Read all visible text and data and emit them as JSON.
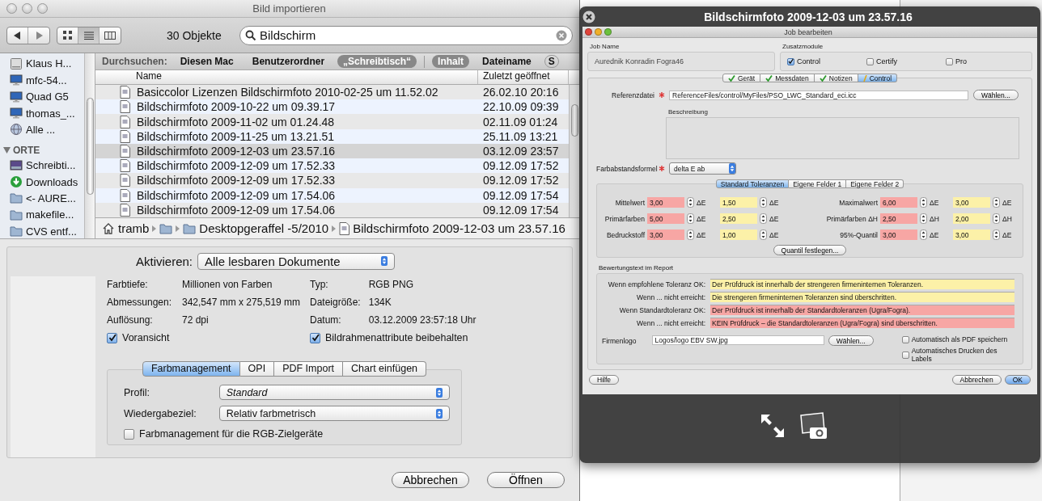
{
  "import_dialog": {
    "title": "Bild importieren",
    "toolbar": {
      "view_modes": [
        {
          "kind": "icons",
          "selected": false
        },
        {
          "kind": "list",
          "selected": true
        },
        {
          "kind": "columns",
          "selected": false
        }
      ],
      "count": "30 Objekte",
      "search": {
        "value": "Bildschirm"
      }
    },
    "sidebar": {
      "devices": [
        {
          "label": "Klaus H...",
          "kind": "drive"
        },
        {
          "label": "mfc-54...",
          "kind": "monitor"
        },
        {
          "label": "Quad G5",
          "kind": "monitor"
        },
        {
          "label": "thomas_...",
          "kind": "monitor"
        },
        {
          "label": "Alle ...",
          "kind": "network"
        }
      ],
      "places_heading": "ORTE",
      "places": [
        {
          "label": "Schreibti...",
          "kind": "desktop"
        },
        {
          "label": "Downloads",
          "kind": "downloads"
        },
        {
          "label": "<- AURE...",
          "kind": "folder"
        },
        {
          "label": "makefile...",
          "kind": "folder"
        },
        {
          "label": "CVS entf...",
          "kind": "folder"
        }
      ]
    },
    "scope_bar": {
      "label": "Durchsuchen:",
      "scopes": [
        {
          "label": "Diesen Mac",
          "selected": false
        },
        {
          "label": "Benutzerordner",
          "selected": false
        },
        {
          "label": "„Schreibtisch“",
          "selected": true
        }
      ],
      "fields": [
        {
          "label": "Inhalt",
          "selected": true
        },
        {
          "label": "Dateiname",
          "selected": false
        },
        {
          "label": "S",
          "selected": false
        }
      ]
    },
    "table": {
      "columns": [
        "Name",
        "Zuletzt geöffnet"
      ],
      "rows": [
        {
          "name": "Basiccolor Lizenzen Bildschirmfoto 2010-02-25 um 11.52.02",
          "opened": "26.02.10 20:16",
          "selected": false
        },
        {
          "name": "Bildschirmfoto 2009-10-22 um 09.39.17",
          "opened": "22.10.09 09:39",
          "selected": false
        },
        {
          "name": "Bildschirmfoto 2009-11-02 um 01.24.48",
          "opened": "02.11.09 01:24",
          "selected": false
        },
        {
          "name": "Bildschirmfoto 2009-11-25 um 13.21.51",
          "opened": "25.11.09 13:21",
          "selected": false
        },
        {
          "name": "Bildschirmfoto 2009-12-03 um 23.57.16",
          "opened": "03.12.09 23:57",
          "selected": true
        },
        {
          "name": "Bildschirmfoto 2009-12-09 um 17.52.33",
          "opened": "09.12.09 17:52",
          "selected": false
        },
        {
          "name": "Bildschirmfoto 2009-12-09 um 17.52.33",
          "opened": "09.12.09 17:52",
          "selected": false
        },
        {
          "name": "Bildschirmfoto 2009-12-09 um 17.54.06",
          "opened": "09.12.09 17:54",
          "selected": false
        },
        {
          "name": "Bildschirmfoto 2009-12-09 um 17.54.06",
          "opened": "09.12.09 17:54",
          "selected": false
        }
      ]
    },
    "path_bar": [
      {
        "kind": "home",
        "label": "tramb"
      },
      {
        "kind": "folder"
      },
      {
        "kind": "folder",
        "label": "Desktopgeraffel -5/2010"
      },
      {
        "kind": "file",
        "label": "Bildschirmfoto 2009-12-03 um 23.57.16"
      }
    ],
    "activate": {
      "label": "Aktivieren:",
      "value": "Alle lesbaren Dokumente"
    },
    "info": [
      {
        "label": "Farbtiefe:",
        "value": "Millionen von Farben"
      },
      {
        "label": "Typ:",
        "value": "RGB PNG"
      },
      {
        "label": "Abmessungen:",
        "value": "342,547 mm x 275,519 mm"
      },
      {
        "label": "Dateigröße:",
        "value": "134K"
      },
      {
        "label": "Auflösung:",
        "value": "72 dpi"
      },
      {
        "label": "Datum:",
        "value": "03.12.2009 23:57:18 Uhr"
      }
    ],
    "checkboxes": [
      {
        "label": "Voransicht",
        "checked": true
      },
      {
        "label": "Bildrahmenattribute beibehalten",
        "checked": true
      }
    ],
    "tabs": [
      {
        "label": "Farbmanagement",
        "selected": true
      },
      {
        "label": "OPI",
        "selected": false
      },
      {
        "label": "PDF Import",
        "selected": false
      },
      {
        "label": "Chart einfügen",
        "selected": false
      }
    ],
    "color_management": {
      "popups": [
        {
          "label": "Profil:",
          "value": "Standard",
          "italic": true
        },
        {
          "label": "Wiedergabeziel:",
          "value": "Relativ farbmetrisch",
          "italic": false
        }
      ],
      "checkbox": {
        "label": "Farbmanagement für die RGB-Zielgeräte",
        "checked": false
      }
    },
    "buttons": [
      {
        "label": "Abbrechen",
        "default": false
      },
      {
        "label": "Öffnen",
        "default": false
      }
    ]
  },
  "quicklook": {
    "title": "Bildschirmfoto 2009-12-03 um 23.57.16",
    "job_window": {
      "title": "Job bearbeiten",
      "job_name": {
        "label": "Job Name",
        "value": "Aurednik Konradin Fogra46"
      },
      "modules": {
        "label": "Zusatzmodule",
        "items": [
          {
            "label": "Control",
            "checked": true
          },
          {
            "label": "Certify",
            "checked": false
          },
          {
            "label": "Pro",
            "checked": false
          }
        ]
      },
      "tabs": [
        {
          "label": "Gerät",
          "complete": true,
          "selected": false
        },
        {
          "label": "Messdaten",
          "complete": true,
          "selected": false
        },
        {
          "label": "Notizen",
          "complete": true,
          "selected": false
        },
        {
          "label": "Control",
          "complete": false,
          "selected": true
        }
      ],
      "reference": {
        "label": "Referenzdatei",
        "required": true,
        "value": "ReferenceFiles/control/MyFiles/PSO_LWC_Standard_eci.icc",
        "button": "Wählen..."
      },
      "description": {
        "label": "Beschreibung"
      },
      "formula": {
        "label": "Farbabstandsformel",
        "required": true,
        "value": "delta E ab"
      },
      "subtabs": [
        {
          "label": "Standard Toleranzen",
          "selected": true
        },
        {
          "label": "Eigene Felder 1",
          "selected": false
        },
        {
          "label": "Eigene Felder 2",
          "selected": false
        }
      ],
      "tolerances": [
        {
          "label": "Mittelwert",
          "fields": [
            {
              "value": "3,00",
              "unit": "ΔE",
              "kind": "standard"
            },
            {
              "value": "1,50",
              "unit": "ΔE",
              "kind": "recommended"
            }
          ]
        },
        {
          "label": "Maximalwert",
          "fields": [
            {
              "value": "6,00",
              "unit": "ΔE",
              "kind": "standard"
            },
            {
              "value": "3,00",
              "unit": "ΔE",
              "kind": "recommended"
            }
          ]
        },
        {
          "label": "Primärfarben",
          "fields": [
            {
              "value": "5,00",
              "unit": "ΔE",
              "kind": "standard"
            },
            {
              "value": "2,50",
              "unit": "ΔE",
              "kind": "recommended"
            }
          ]
        },
        {
          "label": "Primärfarben ΔH",
          "fields": [
            {
              "value": "2,50",
              "unit": "ΔH",
              "kind": "standard"
            },
            {
              "value": "2,00",
              "unit": "ΔH",
              "kind": "recommended"
            }
          ]
        },
        {
          "label": "Bedruckstoff",
          "fields": [
            {
              "value": "3,00",
              "unit": "ΔE",
              "kind": "standard"
            },
            {
              "value": "1,00",
              "unit": "ΔE",
              "kind": "recommended"
            }
          ]
        },
        {
          "label": "95%-Quantil",
          "fields": [
            {
              "value": "3,00",
              "unit": "ΔE",
              "kind": "standard"
            },
            {
              "value": "3,00",
              "unit": "ΔE",
              "kind": "recommended"
            }
          ]
        }
      ],
      "quantile_button": "Quantil festlegen...",
      "report": {
        "label": "Bewertungstext im Report",
        "rows": [
          {
            "label": "Wenn empfohlene Toleranz OK:",
            "text": "Der Prüfdruck ist innerhalb der strengeren firmeninternen Toleranzen.",
            "kind": "recommended"
          },
          {
            "label": "Wenn ... nicht erreicht:",
            "text": "Die strengeren firmeninternen Toleranzen sind überschritten.",
            "kind": "recommended"
          },
          {
            "label": "Wenn Standardtoleranz OK:",
            "text": "Der Prüfdruck ist innerhalb der Standardtoleranzen (Ugra/Fogra).",
            "kind": "standard"
          },
          {
            "label": "Wenn ... nicht erreicht:",
            "text": "KEIN Prüfdruck – die Standardtoleranzen (Ugra/Fogra) sind überschritten.",
            "kind": "standard"
          }
        ],
        "logo": {
          "label": "Firmenlogo",
          "value": "Logos/logo EBV SW.jpg",
          "button": "Wählen..."
        },
        "options": [
          {
            "label": "Automatisch als PDF speichern",
            "checked": false
          },
          {
            "label": "Automatisches Drucken des Labels",
            "checked": false
          }
        ]
      },
      "buttons": [
        {
          "label": "Hilfe",
          "default": false
        },
        {
          "label": "Abbrechen",
          "default": false
        },
        {
          "label": "OK",
          "default": true
        }
      ]
    }
  }
}
